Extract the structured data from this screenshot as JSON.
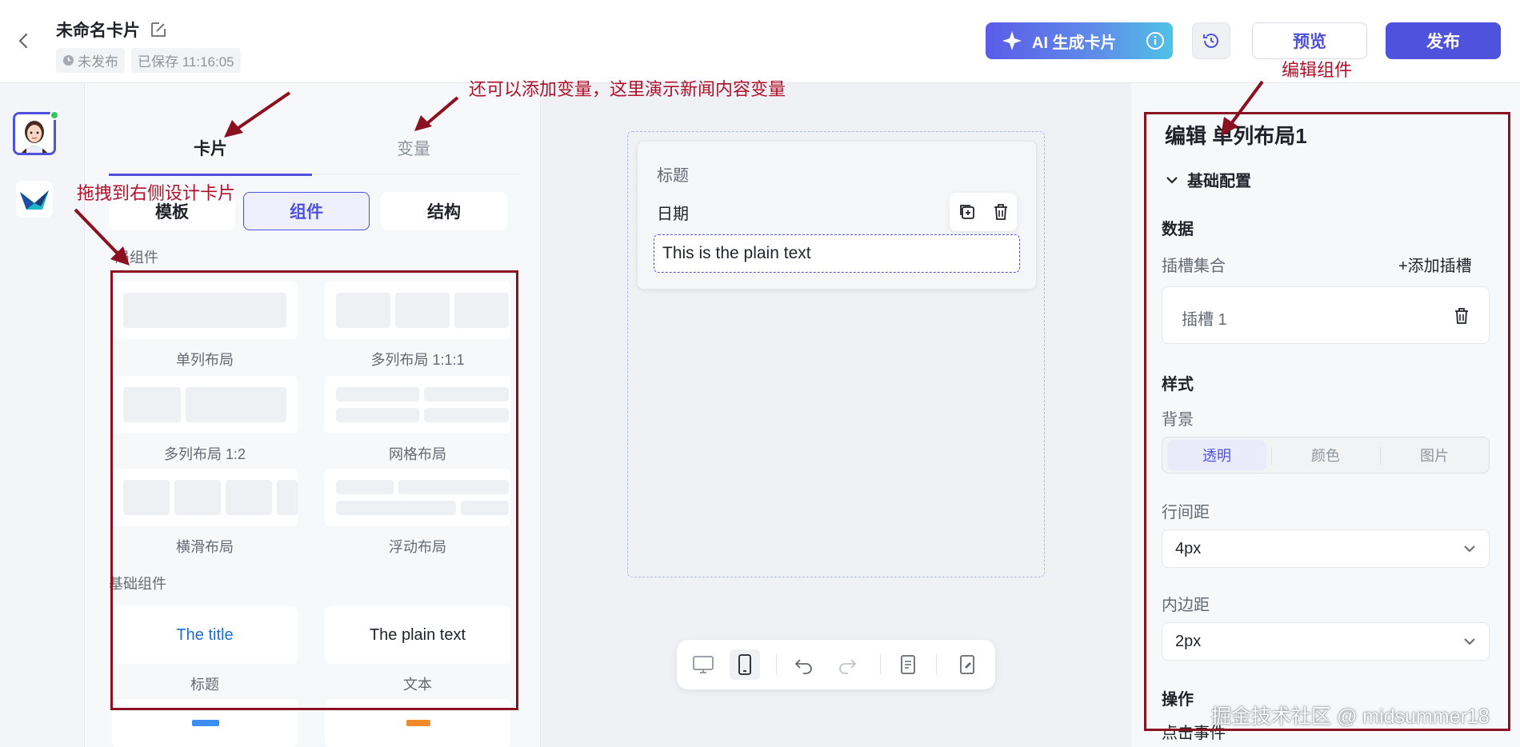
{
  "header": {
    "title": "未命名卡片",
    "status_unpublished": "未发布",
    "status_saved": "已保存 11:16:05",
    "ai_button": "AI 生成卡片",
    "preview_button": "预览",
    "publish_button": "发布"
  },
  "left_panel": {
    "tabs": [
      "卡片",
      "变量"
    ],
    "segments": [
      "模板",
      "组件",
      "结构"
    ],
    "layout_section": "局组件",
    "layout_components": [
      "单列布局",
      "多列布局 1:1:1",
      "多列布局 1:2",
      "网格布局",
      "横滑布局",
      "浮动布局"
    ],
    "basic_section": "基础组件",
    "basic_components": [
      {
        "preview": "The title",
        "label": "标题"
      },
      {
        "preview": "The plain text",
        "label": "文本"
      }
    ]
  },
  "canvas": {
    "card_title": "标题",
    "card_date": "日期",
    "card_text": "This is the plain text"
  },
  "right_panel": {
    "heading": "编辑 单列布局1",
    "section": "基础配置",
    "data_heading": "数据",
    "slot_collection_label": "插槽集合",
    "add_slot": "+添加插槽",
    "slot_item": "插槽 1",
    "style_heading": "样式",
    "background_label": "背景",
    "background_options": [
      "透明",
      "颜色",
      "图片"
    ],
    "line_spacing_label": "行间距",
    "line_spacing_value": "4px",
    "padding_label": "内边距",
    "padding_value": "2px",
    "actions_heading": "操作",
    "click_event_label": "点击事件"
  },
  "annotations": {
    "variable_note": "还可以添加变量，这里演示新闻内容变量",
    "edit_component_note": "编辑组件",
    "drag_note": "拖拽到右侧设计卡片"
  },
  "watermark": "掘金技术社区 @ midsummer18",
  "colors": {
    "accent": "#4e52dc",
    "annotation": "#b0122b",
    "annotation_box": "#8b1020",
    "title_blue": "#1f6fd1"
  }
}
